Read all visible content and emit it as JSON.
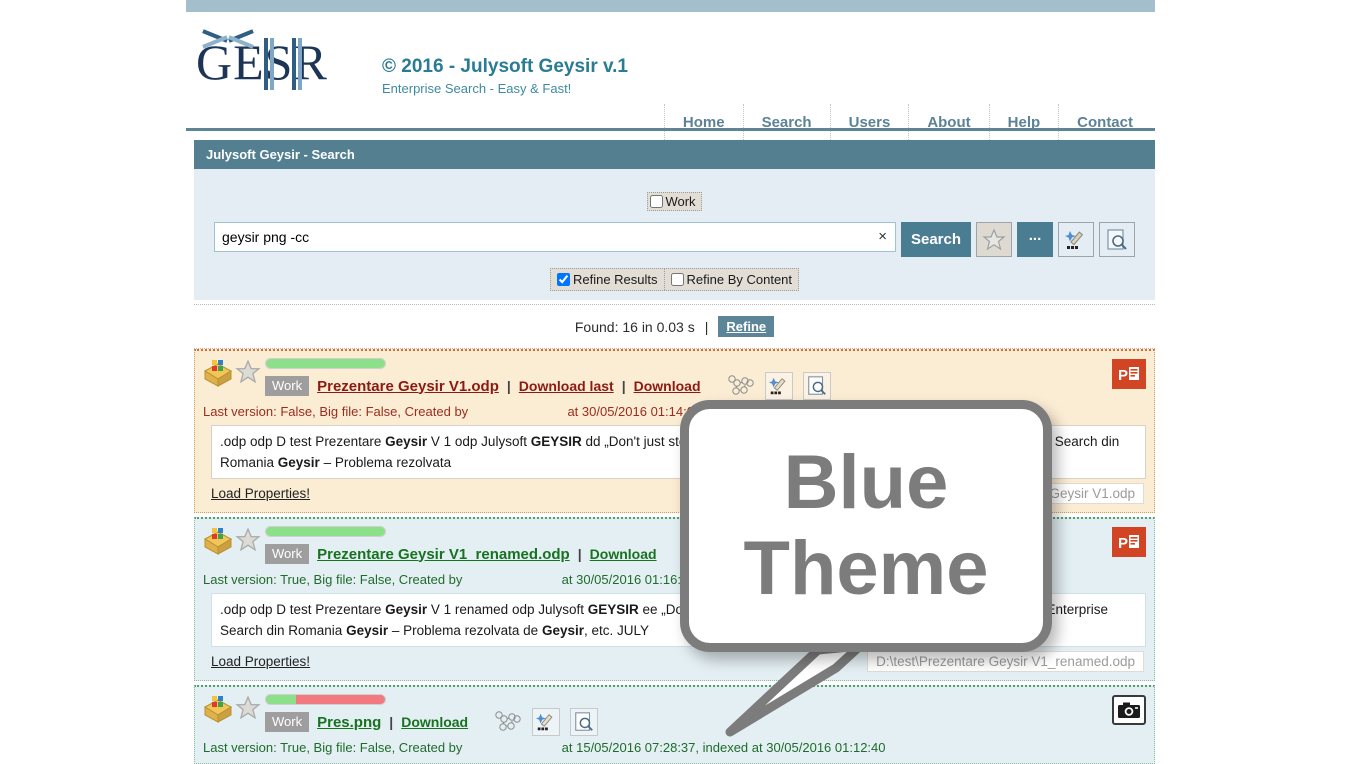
{
  "theme": {
    "accent": "#547f91",
    "top_strip": "#a3bfcb",
    "brand_teal": "#2a7b94",
    "panel_bg": "#e3edf3",
    "result_tan": "#fbecd4",
    "result_blue": "#e4eff3"
  },
  "header": {
    "logo_text": "GESR",
    "logo_name": "geysir-logo",
    "title": "© 2016 - Julysoft Geysir v.1",
    "subtitle": "Enterprise Search - Easy & Fast!"
  },
  "nav": {
    "items": [
      {
        "label": "Home"
      },
      {
        "label": "Search"
      },
      {
        "label": "Users"
      },
      {
        "label": "About"
      },
      {
        "label": "Help"
      },
      {
        "label": "Contact"
      }
    ]
  },
  "page_title": "Julysoft Geysir - Search",
  "search": {
    "work_checkbox": {
      "label": "Work",
      "checked": false
    },
    "value": "geysir png -cc",
    "placeholder": "",
    "clear_glyph": "×",
    "search_button": "Search",
    "buttons": [
      {
        "name": "favorite-button",
        "icon": "star-icon",
        "label": ""
      },
      {
        "name": "more-options-button",
        "icon": "dots-icon",
        "label": "..."
      },
      {
        "name": "magic-wand-button",
        "icon": "magic-wand-icon",
        "label": ""
      },
      {
        "name": "preview-button",
        "icon": "document-search-icon",
        "label": ""
      }
    ],
    "refine_results": {
      "label": "Refine Results",
      "checked": true
    },
    "refine_by_content": {
      "label": "Refine By Content",
      "checked": false
    }
  },
  "results_bar": {
    "found_text": "Found: 16 in 0.03 s",
    "divider": "|",
    "refine_link": "Refine"
  },
  "results": [
    {
      "theme": "tan",
      "relevance_percent": 100,
      "work_tag": "Work",
      "file_name": "Prezentare Geysir V1.odp",
      "links": [
        "Download last",
        "Download"
      ],
      "meta_prefix": "Last version: False, Big file: False, Created by",
      "meta_suffix": "at 30/05/2016 01:14:06, indexed at 30/05/2016 01:14:06",
      "snippet": ".odp odp D test Prezentare Geysir V 1 odp Julysoft GEYSIR dd „Don't just store, find!” JULYSOFT a lansat GEYSIR v.1 – primul Enterprise Search din Romania Geysir – Problema rezolvata",
      "snippet_bold": [
        "Geysir",
        "GEYSIR"
      ],
      "load_properties": "Load Properties!",
      "path_chip": "D:\\test\\Prezentare Geysir V1.odp",
      "file_type_icon": "powerpoint-icon",
      "tools": [
        "graph-icon",
        "magic-wand-icon",
        "document-search-icon"
      ]
    },
    {
      "theme": "blue",
      "relevance_percent": 100,
      "work_tag": "Work",
      "file_name": "Prezentare Geysir V1_renamed.odp",
      "links": [
        "Download"
      ],
      "meta_prefix": "Last version: True, Big file: False, Created by",
      "meta_suffix": "at 30/05/2016 01:16:06, indexed at 30/05/2016 01:16:06",
      "snippet": ".odp odp D test Prezentare Geysir V 1 renamed odp Julysoft GEYSIR ee „Don't just store, find!” JULYSOFT a lansat GEYSIR v.1 – primul Enterprise Search din Romania Geysir – Problema rezolvata de Geysir, etc. JULY",
      "snippet_bold": [
        "Geysir",
        "GEYSIR"
      ],
      "load_properties": "Load Properties!",
      "path_chip": "D:\\test\\Prezentare Geysir V1_renamed.odp",
      "file_type_icon": "powerpoint-icon",
      "tools": [
        "graph-icon",
        "magic-wand-icon",
        "document-search-icon"
      ]
    },
    {
      "theme": "blue",
      "relevance_percent": 25,
      "work_tag": "Work",
      "file_name": "Pres.png",
      "links": [
        "Download"
      ],
      "meta_prefix": "Last version: True, Big file: False, Created by",
      "meta_suffix": "at 15/05/2016 07:28:37, indexed at 30/05/2016 01:12:40",
      "snippet": "",
      "snippet_bold": [],
      "load_properties": "",
      "path_chip": "",
      "file_type_icon": "camera-icon",
      "tools": [
        "graph-icon",
        "magic-wand-icon",
        "document-search-icon"
      ]
    }
  ],
  "callout": {
    "line1": "Blue",
    "line2": "Theme",
    "color": "#7c7c7c"
  }
}
